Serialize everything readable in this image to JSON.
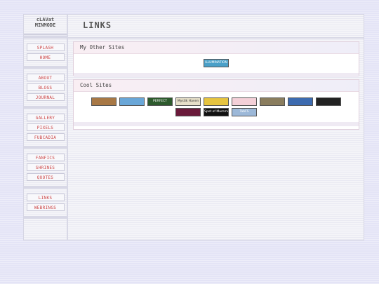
{
  "site": {
    "brand_line1": "cLAVat",
    "brand_line2": "MINMODE"
  },
  "header": {
    "title": "LINKS"
  },
  "nav": {
    "groups": [
      [
        "SPLASH",
        "HOME"
      ],
      [
        "ABOUT",
        "BLOGS",
        "JOURNAL"
      ],
      [
        "GALLERY",
        "PIXELS",
        "FUBCADIA"
      ],
      [
        "FANFICS",
        "SHRINES",
        "QUOTES"
      ],
      [
        "LINKS",
        "WEBRINGS"
      ]
    ]
  },
  "my_sites": {
    "heading": "My Other Sites",
    "buttons": [
      {
        "text": "ILLUMINATION",
        "bg": "#4aa0c8",
        "fg": "#fff"
      }
    ]
  },
  "cool_sites": {
    "heading": "Cool Sites",
    "row1": [
      {
        "text": "",
        "bg": "#a87845",
        "fg": "#fff"
      },
      {
        "text": "",
        "bg": "#6aa7d8",
        "fg": "#fff"
      },
      {
        "text": "PERFECT",
        "bg": "#2d5a2d",
        "fg": "#fff"
      },
      {
        "text": "Mystik Haven",
        "bg": "#e6dfc9",
        "fg": "#333"
      },
      {
        "text": "",
        "bg": "#e6c440",
        "fg": "#333"
      },
      {
        "text": "",
        "bg": "#f4d0d8",
        "fg": "#c33"
      },
      {
        "text": "",
        "bg": "#8a7d5e",
        "fg": "#fff"
      },
      {
        "text": "",
        "bg": "#3d6bb0",
        "fg": "#fff"
      },
      {
        "text": "",
        "bg": "#222222",
        "fg": "#fff"
      }
    ],
    "row2": [
      {
        "text": "",
        "bg": "#6a1a3a",
        "fg": "#ff8"
      },
      {
        "text": "Spot of Mummery",
        "bg": "#111111",
        "fg": "#fff"
      },
      {
        "text": "TabFS",
        "bg": "#9cb8d8",
        "fg": "#fff"
      }
    ]
  }
}
